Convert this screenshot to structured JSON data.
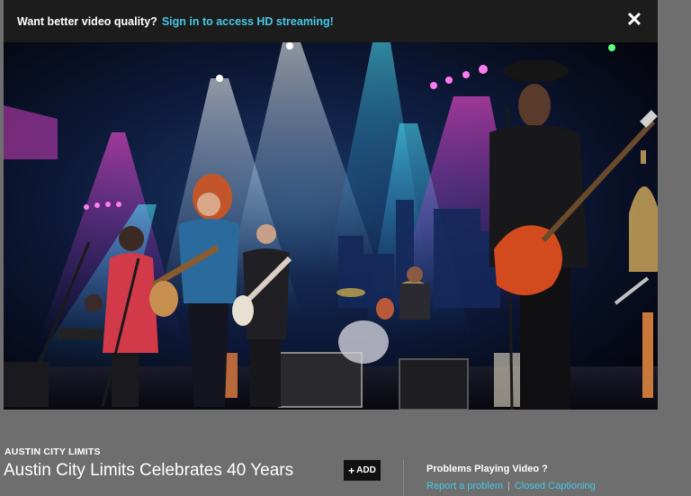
{
  "banner": {
    "prompt": "Want better video quality?",
    "signin_link": "Sign in to access HD streaming!",
    "close_glyph": "✕"
  },
  "video": {
    "description": "concert-stage-frame"
  },
  "info": {
    "show_label": "AUSTIN CITY LIMITS",
    "episode_title": "Austin City Limits Celebrates 40 Years",
    "add_button": "ADD",
    "add_icon": "+",
    "help_title": "Problems Playing Video ?",
    "report_link": "Report a problem",
    "separator": "|",
    "captions_link": "Closed Captioning"
  },
  "colors": {
    "page_bg": "#6e6e6e",
    "banner_bg": "#1c1c1c",
    "accent": "#46c8e8"
  }
}
